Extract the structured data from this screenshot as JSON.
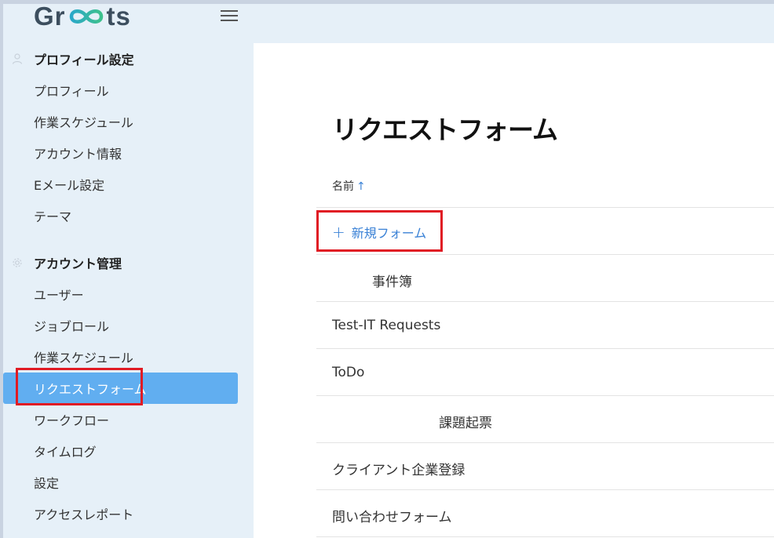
{
  "app": {
    "logo_text_left": "Gr",
    "logo_text_right": "ts"
  },
  "sidebar": {
    "sections": [
      {
        "title": "プロフィール設定",
        "icon": "user-icon",
        "items": [
          "プロフィール",
          "作業スケジュール",
          "アカウント情報",
          "Eメール設定",
          "テーマ"
        ]
      },
      {
        "title": "アカウント管理",
        "icon": "gear-icon",
        "items": [
          "ユーザー",
          "ジョブロール",
          "作業スケジュール",
          "リクエストフォーム",
          "ワークフロー",
          "タイムログ",
          "設定",
          "アクセスレポート"
        ]
      }
    ],
    "active_item": "リクエストフォーム"
  },
  "main": {
    "title": "リクエストフォーム",
    "column_header": "名前",
    "sort_indicator": "↑",
    "new_form_label": "新規フォーム",
    "new_form_icon": "plus-icon",
    "rows": [
      "　　　事件簿",
      "Test-IT Requests",
      "ToDo",
      "　　　　　　　　課題起票",
      "クライアント企業登録",
      "問い合わせフォーム"
    ]
  },
  "colors": {
    "accent": "#3b82d6",
    "active_bg": "#61aef0",
    "highlight": "#e01b24",
    "sidebar_bg": "#e6f0f8"
  }
}
